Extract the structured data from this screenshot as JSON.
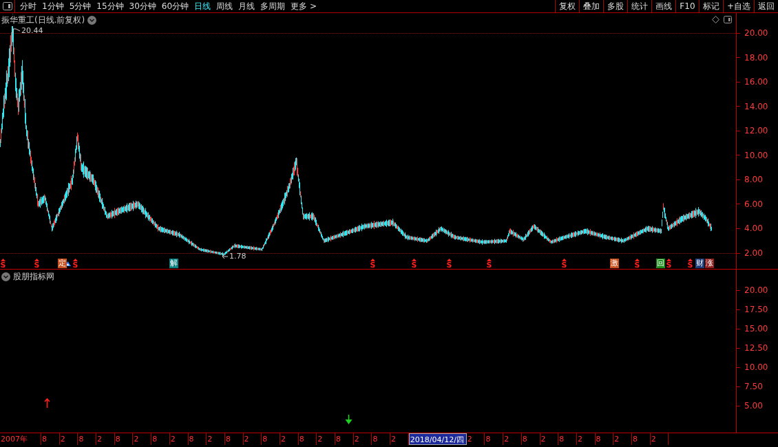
{
  "toolbar": {
    "periods": [
      {
        "label": "分时",
        "selected": false
      },
      {
        "label": "1分钟",
        "selected": false
      },
      {
        "label": "5分钟",
        "selected": false
      },
      {
        "label": "15分钟",
        "selected": false
      },
      {
        "label": "30分钟",
        "selected": false
      },
      {
        "label": "60分钟",
        "selected": false
      },
      {
        "label": "日线",
        "selected": true
      },
      {
        "label": "周线",
        "selected": false
      },
      {
        "label": "月线",
        "selected": false
      },
      {
        "label": "多周期",
        "selected": false
      },
      {
        "label": "更多 >",
        "selected": false
      }
    ],
    "actions": [
      "复权",
      "叠加",
      "多股",
      "统计",
      "画线",
      "F10",
      "标记",
      "+自选",
      "返回"
    ]
  },
  "main_chart": {
    "title": "振华重工(日线.前复权)",
    "high_label": "20.44",
    "low_label": "1.78",
    "yticks": [
      "20.00",
      "18.00",
      "16.00",
      "14.00",
      "12.00",
      "10.00",
      "8.00",
      "6.00",
      "4.00",
      "2.00"
    ],
    "markers": [
      {
        "kind": "signal",
        "text": "S"
      },
      {
        "kind": "signal",
        "text": "S"
      },
      {
        "kind": "badge",
        "text": "定",
        "color": "#c8501e"
      },
      {
        "kind": "signal",
        "text": "S"
      },
      {
        "kind": "badge",
        "text": "解",
        "color": "#0a8080"
      },
      {
        "kind": "signal",
        "text": "S"
      },
      {
        "kind": "signal",
        "text": "S"
      },
      {
        "kind": "signal",
        "text": "S"
      },
      {
        "kind": "signal",
        "text": "S"
      },
      {
        "kind": "signal",
        "text": "S"
      },
      {
        "kind": "badge",
        "text": "激",
        "color": "#c8501e"
      },
      {
        "kind": "signal",
        "text": "S"
      },
      {
        "kind": "badge",
        "text": "回",
        "color": "#1e8c1e"
      },
      {
        "kind": "signal",
        "text": "S"
      },
      {
        "kind": "signal",
        "text": "S"
      },
      {
        "kind": "badge",
        "text": "财",
        "color": "#1e3c78"
      },
      {
        "kind": "badge",
        "text": "涨",
        "color": "#8c1e1e"
      }
    ]
  },
  "indicator_panel": {
    "title": "股朋指标网",
    "yticks": [
      "20.00",
      "17.50",
      "15.00",
      "12.50",
      "10.00",
      "7.50",
      "5.00"
    ]
  },
  "time_axis": {
    "labels": [
      {
        "kind": "year",
        "text": "2007年"
      },
      {
        "kind": "tick",
        "text": "8"
      },
      {
        "kind": "tick",
        "text": "2"
      },
      {
        "kind": "tick",
        "text": "8"
      },
      {
        "kind": "tick",
        "text": "2"
      },
      {
        "kind": "tick",
        "text": "8"
      },
      {
        "kind": "tick",
        "text": "2"
      },
      {
        "kind": "tick",
        "text": "8"
      },
      {
        "kind": "tick",
        "text": "2"
      },
      {
        "kind": "tick",
        "text": "8"
      },
      {
        "kind": "tick",
        "text": "2"
      },
      {
        "kind": "tick",
        "text": "8"
      },
      {
        "kind": "tick",
        "text": "2"
      },
      {
        "kind": "tick",
        "text": "8"
      },
      {
        "kind": "tick",
        "text": "2"
      },
      {
        "kind": "tick",
        "text": "8"
      },
      {
        "kind": "tick",
        "text": "2"
      },
      {
        "kind": "tick",
        "text": "8"
      },
      {
        "kind": "tick",
        "text": "2"
      },
      {
        "kind": "tick",
        "text": "8"
      },
      {
        "kind": "tick",
        "text": "2"
      },
      {
        "kind": "cursor",
        "text": "2018/04/12/四"
      },
      {
        "kind": "tick",
        "text": "2"
      },
      {
        "kind": "tick",
        "text": "8"
      },
      {
        "kind": "tick",
        "text": "2"
      },
      {
        "kind": "tick",
        "text": "8"
      },
      {
        "kind": "tick",
        "text": "2"
      },
      {
        "kind": "tick",
        "text": "8"
      },
      {
        "kind": "tick",
        "text": "2"
      },
      {
        "kind": "tick",
        "text": "8"
      },
      {
        "kind": "tick",
        "text": "2"
      },
      {
        "kind": "tick",
        "text": "8"
      },
      {
        "kind": "tick",
        "text": "2"
      }
    ]
  }
}
